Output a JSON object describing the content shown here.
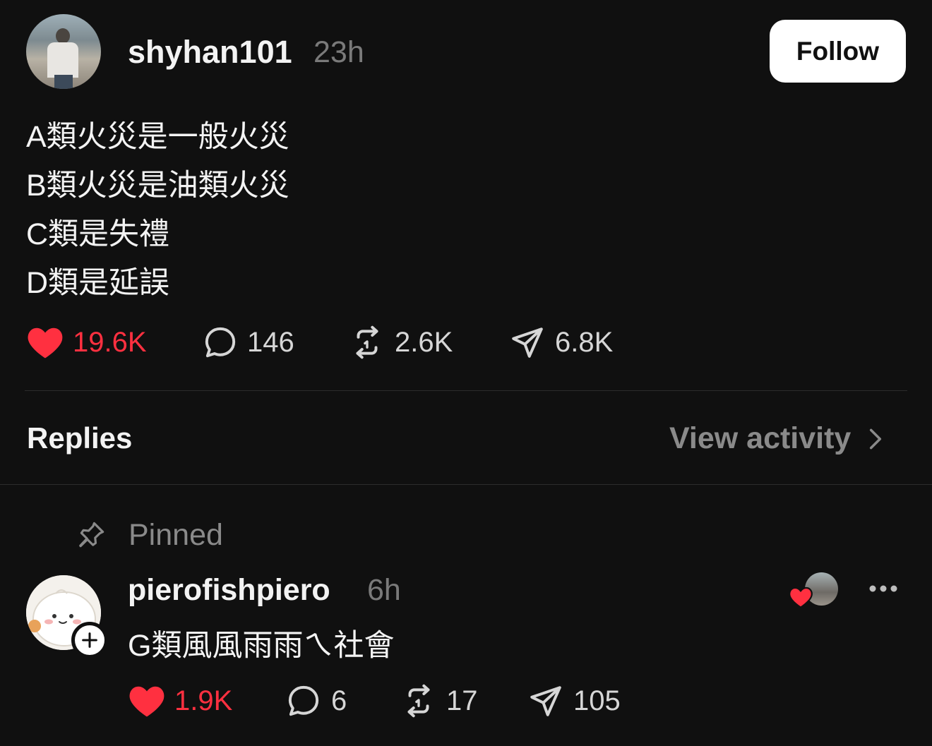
{
  "post": {
    "username": "shyhan101",
    "time": "23h",
    "follow_label": "Follow",
    "lines": [
      "A類火災是一般火災",
      "B類火災是油類火災",
      "C類是失禮",
      "D類是延誤"
    ],
    "stats": {
      "likes": "19.6K",
      "comments": "146",
      "reposts": "2.6K",
      "shares": "6.8K"
    },
    "liked": true
  },
  "replies_header": {
    "title": "Replies",
    "view_activity": "View activity"
  },
  "pinned_reply": {
    "pinned_label": "Pinned",
    "username": "pierofishpiero",
    "time": "6h",
    "text": "G類風風雨雨ㄟ社會",
    "stats": {
      "likes": "1.9K",
      "comments": "6",
      "reposts": "17",
      "shares": "105"
    },
    "liked": true,
    "liked_by_author": true
  },
  "colors": {
    "background": "#101010",
    "text": "#f3f3f3",
    "muted": "#7a7a7a",
    "like_red": "#ff3040",
    "divider": "#2d2d2d"
  },
  "icons": [
    "heart-icon",
    "comment-icon",
    "repost-icon",
    "share-icon",
    "pin-icon",
    "chevron-right-icon",
    "more-icon",
    "plus-icon"
  ]
}
